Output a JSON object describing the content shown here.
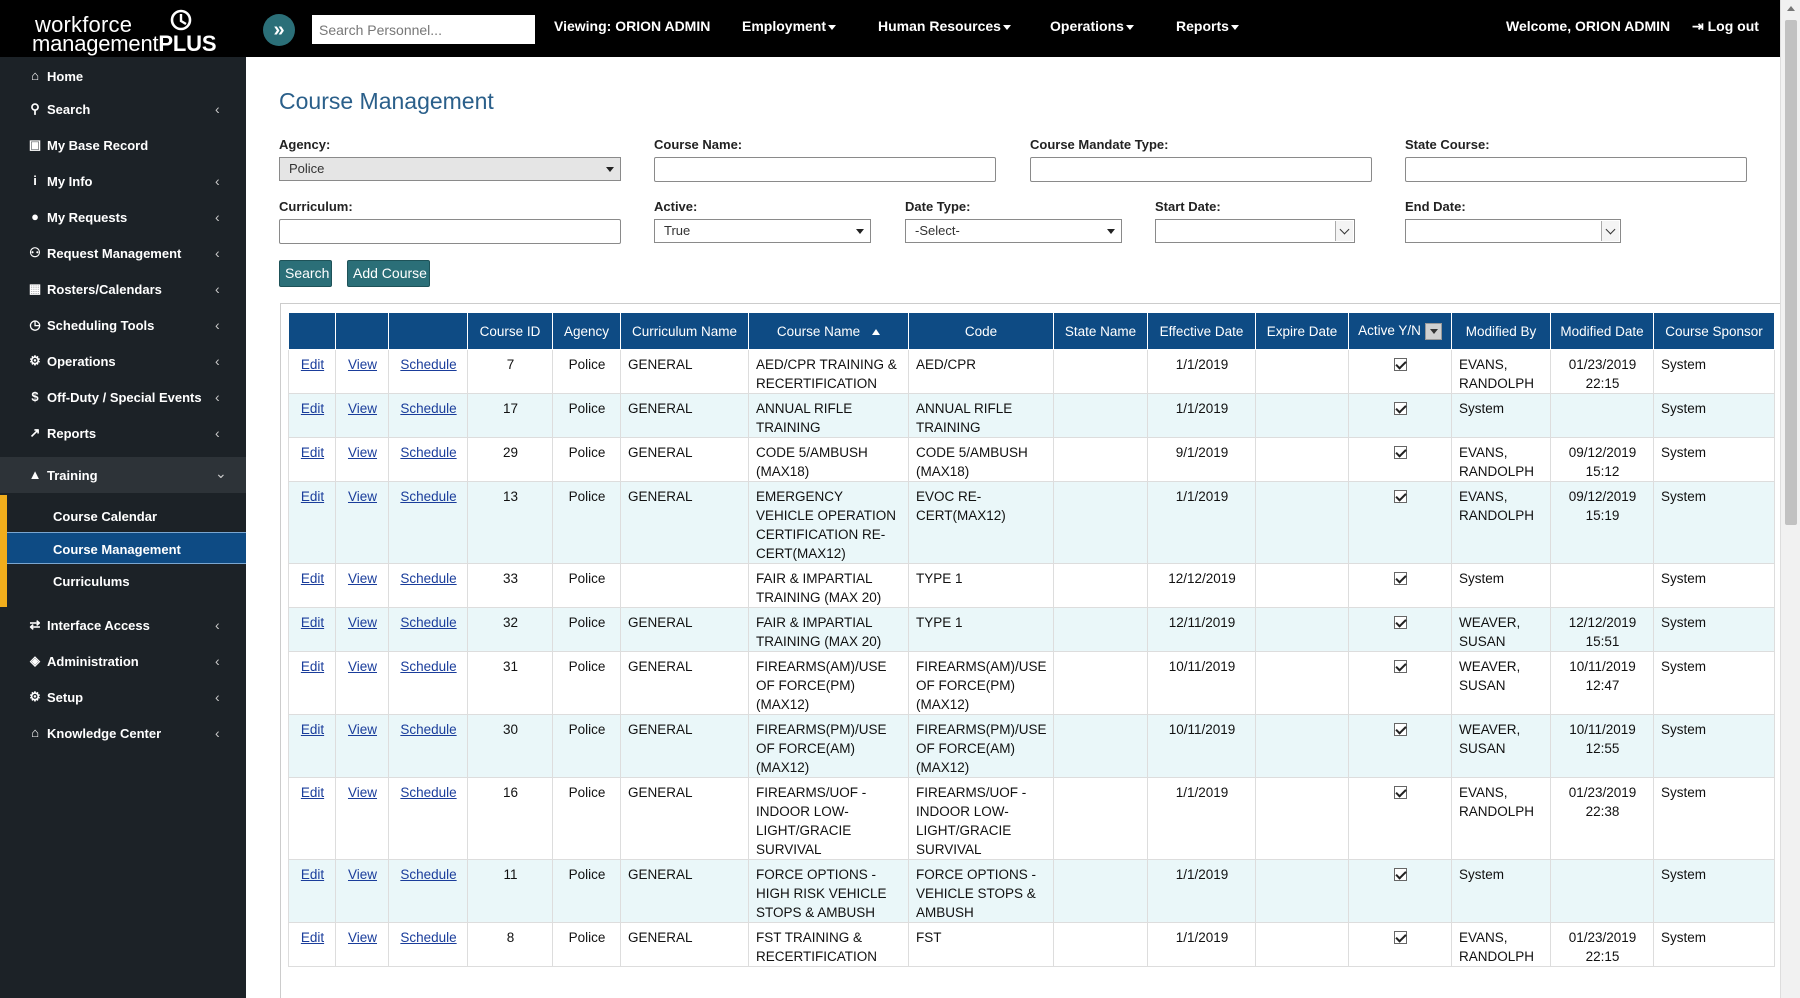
{
  "header": {
    "logo_line1": "workforce",
    "logo_line2_light": "management",
    "logo_line2_bold": "PLUS",
    "search_placeholder": "Search Personnel...",
    "viewing": "Viewing: ORION ADMIN",
    "nav": [
      "Employment",
      "Human Resources",
      "Operations",
      "Reports"
    ],
    "welcome": "Welcome, ORION ADMIN",
    "logout": "Log out"
  },
  "sidebar": {
    "items": [
      {
        "label": "Home",
        "icon": "home-icon",
        "glyph": "⌂",
        "chevron": false
      },
      {
        "label": "Search",
        "icon": "search-icon",
        "glyph": "⚲",
        "chevron": true
      },
      {
        "label": "My Base Record",
        "icon": "id-card-icon",
        "glyph": "▣",
        "chevron": false
      },
      {
        "label": "My Info",
        "icon": "info-icon",
        "glyph": "i",
        "chevron": true
      },
      {
        "label": "My Requests",
        "icon": "user-icon",
        "glyph": "●",
        "chevron": true
      },
      {
        "label": "Request Management",
        "icon": "users-icon",
        "glyph": "⚇",
        "chevron": true
      },
      {
        "label": "Rosters/Calendars",
        "icon": "calendar-icon",
        "glyph": "▦",
        "chevron": true
      },
      {
        "label": "Scheduling Tools",
        "icon": "clock-icon",
        "glyph": "◷",
        "chevron": true
      },
      {
        "label": "Operations",
        "icon": "gears-icon",
        "glyph": "⚙",
        "chevron": true
      },
      {
        "label": "Off-Duty / Special Events",
        "icon": "dollar-icon",
        "glyph": "$",
        "chevron": true
      },
      {
        "label": "Reports",
        "icon": "chart-icon",
        "glyph": "↗",
        "chevron": true
      },
      {
        "label": "Training",
        "icon": "graduation-cap-icon",
        "glyph": "▲",
        "chevron": true
      },
      {
        "label": "Interface Access",
        "icon": "exchange-icon",
        "glyph": "⇄",
        "chevron": true
      },
      {
        "label": "Administration",
        "icon": "shield-icon",
        "glyph": "◈",
        "chevron": true
      },
      {
        "label": "Setup",
        "icon": "gear-icon",
        "glyph": "⚙",
        "chevron": true
      },
      {
        "label": "Knowledge Center",
        "icon": "bank-icon",
        "glyph": "⌂",
        "chevron": true
      }
    ],
    "training_sub": [
      "Course Calendar",
      "Course Management",
      "Curriculums"
    ]
  },
  "page": {
    "title": "Course Management",
    "filters": {
      "agency_label": "Agency:",
      "agency_value": "Police",
      "course_name_label": "Course Name:",
      "course_name_value": "",
      "mandate_label": "Course Mandate Type:",
      "mandate_value": "",
      "state_course_label": "State Course:",
      "state_course_value": "",
      "curriculum_label": "Curriculum:",
      "curriculum_value": "",
      "active_label": "Active:",
      "active_value": "True",
      "date_type_label": "Date Type:",
      "date_type_value": "-Select-",
      "start_date_label": "Start Date:",
      "start_date_value": "",
      "end_date_label": "End Date:",
      "end_date_value": ""
    },
    "search_button": "Search",
    "add_course_button": "Add Course"
  },
  "table": {
    "columns": [
      "",
      "",
      "",
      "Course ID",
      "Agency",
      "Curriculum Name",
      "Course Name",
      "Code",
      "State Name",
      "Effective Date",
      "Expire Date",
      "Active Y/N",
      "Modified By",
      "Modified Date",
      "Course Sponsor"
    ],
    "action_labels": {
      "edit": "Edit",
      "view": "View",
      "schedule": "Schedule"
    },
    "rows": [
      {
        "id": "7",
        "agency": "Police",
        "curriculum": "GENERAL",
        "course": "AED/CPR TRAINING & RECERTIFICATION",
        "code": "AED/CPR",
        "state": "",
        "effective": "1/1/2019",
        "expire": "",
        "active": true,
        "modified_by": "EVANS, RANDOLPH",
        "modified_date": "01/23/2019 22:15",
        "sponsor": "System"
      },
      {
        "id": "17",
        "agency": "Police",
        "curriculum": "GENERAL",
        "course": "ANNUAL RIFLE TRAINING",
        "code": "ANNUAL RIFLE TRAINING",
        "state": "",
        "effective": "1/1/2019",
        "expire": "",
        "active": true,
        "modified_by": "System",
        "modified_date": "",
        "sponsor": "System"
      },
      {
        "id": "29",
        "agency": "Police",
        "curriculum": "GENERAL",
        "course": "CODE 5/AMBUSH (MAX18)",
        "code": "CODE 5/AMBUSH (MAX18)",
        "state": "",
        "effective": "9/1/2019",
        "expire": "",
        "active": true,
        "modified_by": "EVANS, RANDOLPH",
        "modified_date": "09/12/2019 15:12",
        "sponsor": "System"
      },
      {
        "id": "13",
        "agency": "Police",
        "curriculum": "GENERAL",
        "course": "EMERGENCY VEHICLE OPERATION CERTIFICATION RE-CERT(MAX12)",
        "code": "EVOC RE-CERT(MAX12)",
        "state": "",
        "effective": "1/1/2019",
        "expire": "",
        "active": true,
        "modified_by": "EVANS, RANDOLPH",
        "modified_date": "09/12/2019 15:19",
        "sponsor": "System"
      },
      {
        "id": "33",
        "agency": "Police",
        "curriculum": "",
        "course": "FAIR & IMPARTIAL TRAINING (MAX 20)",
        "code": "TYPE 1",
        "state": "",
        "effective": "12/12/2019",
        "expire": "",
        "active": true,
        "modified_by": "System",
        "modified_date": "",
        "sponsor": "System"
      },
      {
        "id": "32",
        "agency": "Police",
        "curriculum": "GENERAL",
        "course": "FAIR & IMPARTIAL TRAINING (MAX 20)",
        "code": "TYPE 1",
        "state": "",
        "effective": "12/11/2019",
        "expire": "",
        "active": true,
        "modified_by": "WEAVER, SUSAN",
        "modified_date": "12/12/2019 15:51",
        "sponsor": "System"
      },
      {
        "id": "31",
        "agency": "Police",
        "curriculum": "GENERAL",
        "course": "FIREARMS(AM)/USE OF FORCE(PM) (MAX12)",
        "code": "FIREARMS(AM)/USE OF FORCE(PM) (MAX12)",
        "state": "",
        "effective": "10/11/2019",
        "expire": "",
        "active": true,
        "modified_by": "WEAVER, SUSAN",
        "modified_date": "10/11/2019 12:47",
        "sponsor": "System"
      },
      {
        "id": "30",
        "agency": "Police",
        "curriculum": "GENERAL",
        "course": "FIREARMS(PM)/USE OF FORCE(AM) (MAX12)",
        "code": "FIREARMS(PM)/USE OF FORCE(AM) (MAX12)",
        "state": "",
        "effective": "10/11/2019",
        "expire": "",
        "active": true,
        "modified_by": "WEAVER, SUSAN",
        "modified_date": "10/11/2019 12:55",
        "sponsor": "System"
      },
      {
        "id": "16",
        "agency": "Police",
        "curriculum": "GENERAL",
        "course": "FIREARMS/UOF - INDOOR LOW-LIGHT/GRACIE SURVIVAL",
        "code": "FIREARMS/UOF - INDOOR LOW-LIGHT/GRACIE SURVIVAL",
        "state": "",
        "effective": "1/1/2019",
        "expire": "",
        "active": true,
        "modified_by": "EVANS, RANDOLPH",
        "modified_date": "01/23/2019 22:38",
        "sponsor": "System"
      },
      {
        "id": "11",
        "agency": "Police",
        "curriculum": "GENERAL",
        "course": "FORCE OPTIONS - HIGH RISK VEHICLE STOPS & AMBUSH",
        "code": "FORCE OPTIONS - VEHICLE STOPS & AMBUSH",
        "state": "",
        "effective": "1/1/2019",
        "expire": "",
        "active": true,
        "modified_by": "System",
        "modified_date": "",
        "sponsor": "System"
      },
      {
        "id": "8",
        "agency": "Police",
        "curriculum": "GENERAL",
        "course": "FST TRAINING & RECERTIFICATION",
        "code": "FST",
        "state": "",
        "effective": "1/1/2019",
        "expire": "",
        "active": true,
        "modified_by": "EVANS, RANDOLPH",
        "modified_date": "01/23/2019 22:15",
        "sponsor": "System"
      }
    ]
  }
}
